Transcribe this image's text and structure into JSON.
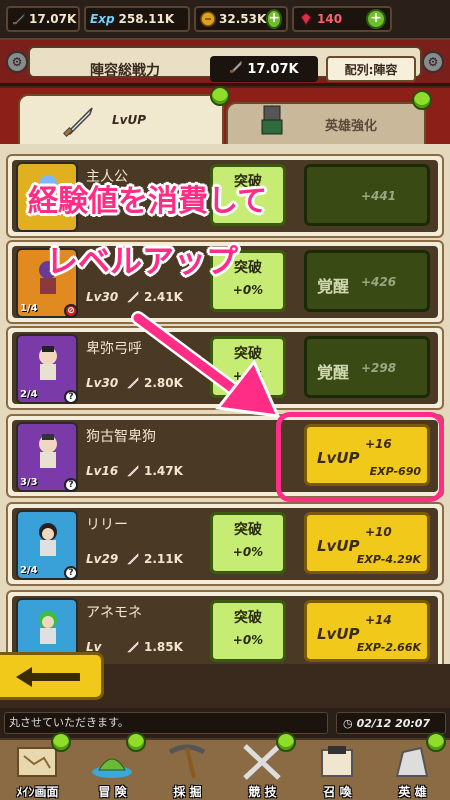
{
  "topbar": {
    "power": "17.07K",
    "exp_label": "Exp",
    "exp": "258.11K",
    "gold": "32.53K",
    "gems": "140",
    "plus": "+"
  },
  "power_bar": {
    "label": "陣容総戦力",
    "value": "17.07K",
    "formation": "配列:陣容"
  },
  "tabs": [
    {
      "label": "LvUP",
      "active": true
    },
    {
      "label": "英雄強化",
      "active": false
    }
  ],
  "heroes": [
    {
      "name": "主人公",
      "break_label": "突破",
      "awaken_gain": "+441"
    },
    {
      "stars": "1/4",
      "level": "Lv30",
      "power": "2.41K",
      "break_label": "突破",
      "break_gain": "+0%",
      "awaken_label": "覚醒",
      "awaken_gain": "+426"
    },
    {
      "name": "卑弥弓呼",
      "stars": "2/4",
      "level": "Lv30",
      "power": "2.80K",
      "break_label": "突破",
      "break_gain": "+0%",
      "awaken_label": "覚醒",
      "awaken_gain": "+298"
    },
    {
      "name": "狗古智卑狗",
      "stars": "3/3",
      "level": "Lv16",
      "power": "1.47K",
      "lvup_label": "LvUP",
      "lvup_gain": "+16",
      "lvup_cost": "EXP-690"
    },
    {
      "name": "リリー",
      "stars": "2/4",
      "level": "Lv29",
      "power": "2.11K",
      "break_label": "突破",
      "break_gain": "+0%",
      "lvup_label": "LvUP",
      "lvup_gain": "+10",
      "lvup_cost": "EXP-4.29K"
    },
    {
      "name": "アネモネ",
      "level": "Lv",
      "power": "1.85K",
      "break_label": "突破",
      "break_gain": "+0%",
      "lvup_label": "LvUP",
      "lvup_gain": "+14",
      "lvup_cost": "EXP-2.66K"
    }
  ],
  "annotation": {
    "line1": "経験値を消費して",
    "line2": "レベルアップ",
    "color": "#ff2d86"
  },
  "chat": {
    "message": "丸させていただきます。",
    "time": "02/12 20:07"
  },
  "nav": [
    "ﾒｲﾝ画面",
    "冒 険",
    "採 掘",
    "競 技",
    "召 喚",
    "英 雄"
  ]
}
